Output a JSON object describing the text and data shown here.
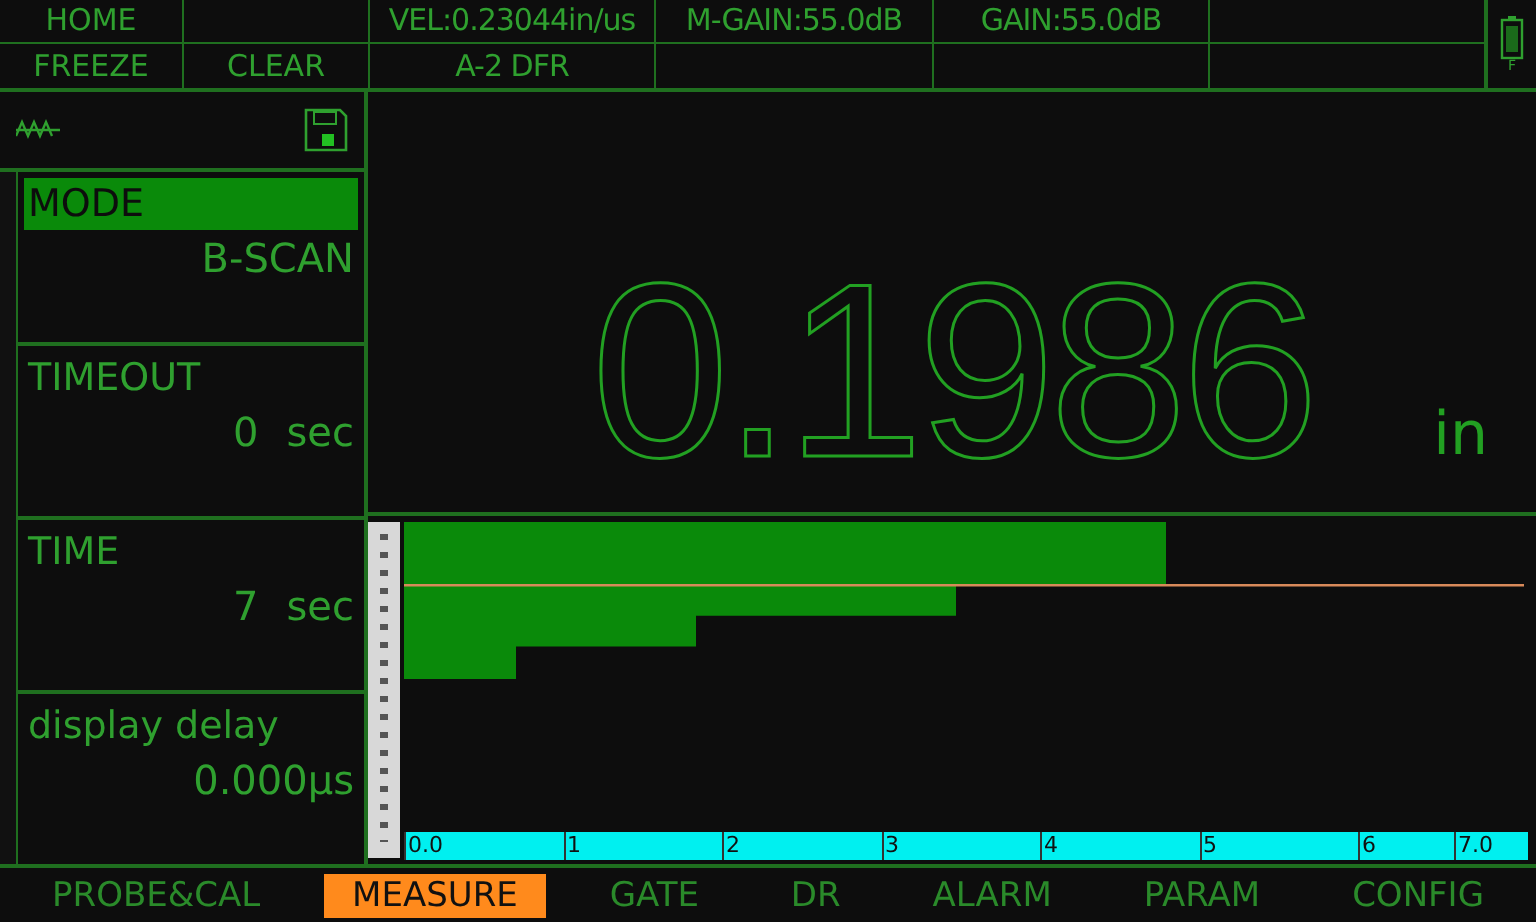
{
  "header": {
    "rows": [
      [
        {
          "label": "HOME"
        },
        {},
        {
          "label": "VEL:0.23044in/us"
        },
        {
          "label": "M-GAIN:55.0dB"
        },
        {
          "label": "GAIN:55.0dB"
        },
        {}
      ],
      [
        {
          "label": "FREEZE"
        },
        {
          "label": "CLEAR"
        },
        {
          "label": "A-2 DFR"
        },
        {},
        {},
        {}
      ]
    ],
    "battery_label": "F"
  },
  "menu": [
    {
      "title": "MODE",
      "value": "B-SCAN",
      "selected": true
    },
    {
      "title": "TIMEOUT",
      "value": "0",
      "unit": "sec",
      "selected": false
    },
    {
      "title": "TIME",
      "value": "7",
      "unit": "sec",
      "selected": false
    },
    {
      "title": "display delay",
      "value": "0.000µs",
      "selected": false
    }
  ],
  "reading": {
    "value": "0.1986",
    "unit": "in"
  },
  "bscan": {
    "axis_labels": [
      "0.0",
      "1",
      "2",
      "3",
      "4",
      "5",
      "6",
      "7.0"
    ]
  },
  "tabs": [
    {
      "label": "PROBE&CAL",
      "selected": false
    },
    {
      "label": "MEASURE",
      "selected": true
    },
    {
      "label": "GATE",
      "selected": false
    },
    {
      "label": "DR",
      "selected": false
    },
    {
      "label": "ALARM",
      "selected": false
    },
    {
      "label": "PARAM",
      "selected": false
    },
    {
      "label": "CONFIG",
      "selected": false
    }
  ]
}
